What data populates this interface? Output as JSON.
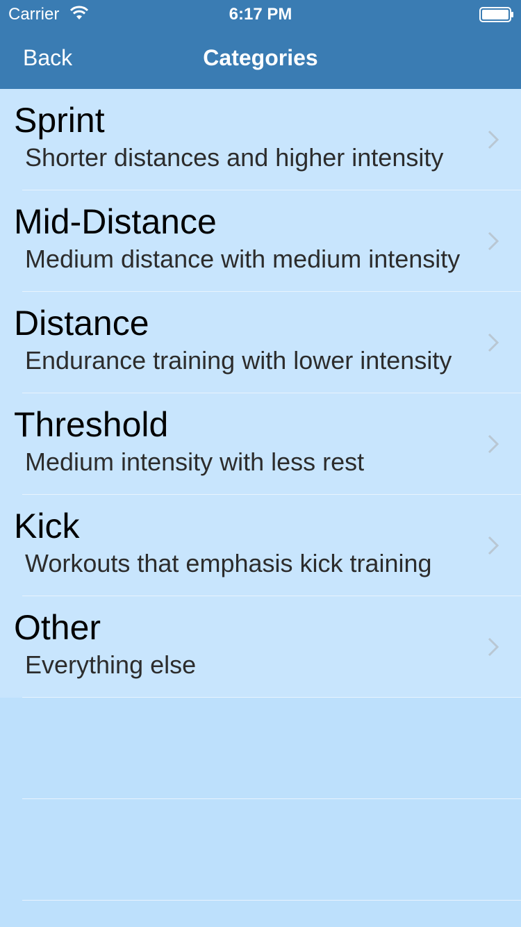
{
  "status_bar": {
    "carrier": "Carrier",
    "time": "6:17 PM",
    "wifi_icon": "wifi-icon",
    "battery_icon": "battery-icon"
  },
  "nav": {
    "back_label": "Back",
    "title": "Categories"
  },
  "categories": [
    {
      "title": "Sprint",
      "subtitle": "Shorter distances and higher intensity"
    },
    {
      "title": "Mid-Distance",
      "subtitle": "Medium distance with medium intensity"
    },
    {
      "title": "Distance",
      "subtitle": "Endurance training with lower intensity"
    },
    {
      "title": "Threshold",
      "subtitle": "Medium intensity with less rest"
    },
    {
      "title": "Kick",
      "subtitle": "Workouts that emphasis kick training"
    },
    {
      "title": "Other",
      "subtitle": "Everything else"
    }
  ],
  "colors": {
    "nav_background": "#3a7cb3",
    "row_background": "#c8e5fd",
    "table_background": "#bde0fc",
    "chevron": "#b9c7d3"
  }
}
